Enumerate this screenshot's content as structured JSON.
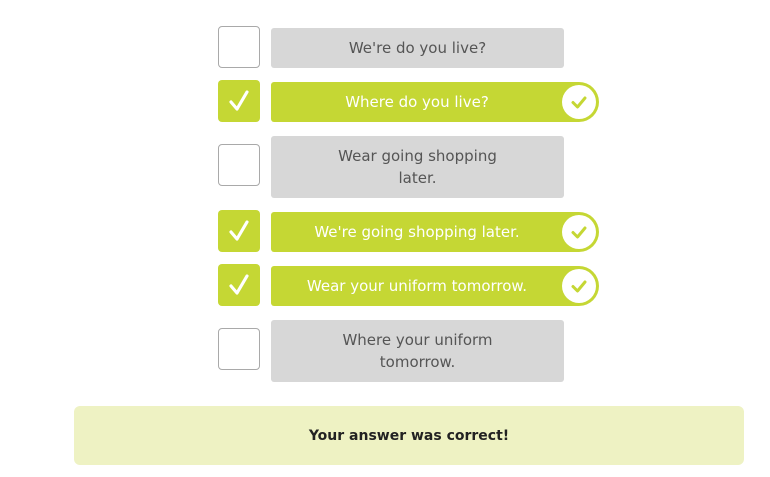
{
  "options": [
    {
      "label": "We're do you live?",
      "checked": false,
      "state": "neutral"
    },
    {
      "label": "Where do you live?",
      "checked": true,
      "state": "correct"
    },
    {
      "label": "Wear going shopping later.",
      "checked": false,
      "state": "neutral"
    },
    {
      "label": "We're going shopping later.",
      "checked": true,
      "state": "correct"
    },
    {
      "label": "Wear your uniform tomorrow.",
      "checked": true,
      "state": "correct"
    },
    {
      "label": "Where your uniform tomorrow.",
      "checked": false,
      "state": "neutral"
    }
  ],
  "feedback": {
    "message": "Your answer was correct!"
  },
  "colors": {
    "accent": "#c5d734",
    "neutral_option": "#d7d7d7",
    "feedback_bg": "#eef2c3"
  }
}
